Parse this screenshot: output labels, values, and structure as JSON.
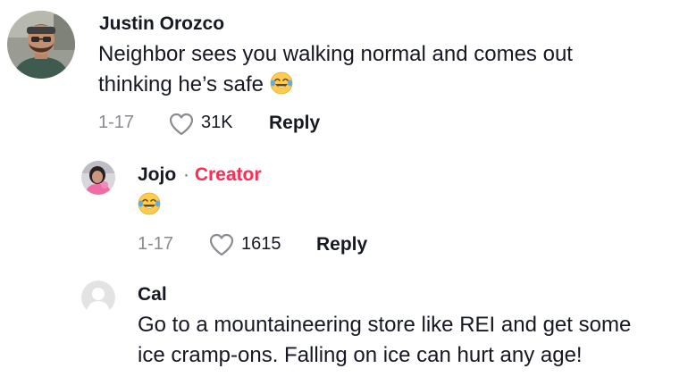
{
  "comments": [
    {
      "username": "Justin Orozco",
      "text_line1": "Neighbor sees you walking normal and comes out",
      "text_line2": "thinking he’s safe",
      "emoji": "face-with-tears-of-joy",
      "date": "1-17",
      "likes": "31K",
      "reply_label": "Reply"
    }
  ],
  "replies": [
    {
      "username": "Jojo",
      "separator": "·",
      "badge": "Creator",
      "emoji": "face-with-tears-of-joy",
      "date": "1-17",
      "likes": "1615",
      "reply_label": "Reply"
    },
    {
      "username": "Cal",
      "text_line1": "Go to a mountaineering store like REI and get some",
      "text_line2": "ice cramp-ons. Falling on ice can hurt any age!"
    }
  ],
  "colors": {
    "text": "#161823",
    "muted": "#8a8b91",
    "creator": "#fe2c55"
  }
}
